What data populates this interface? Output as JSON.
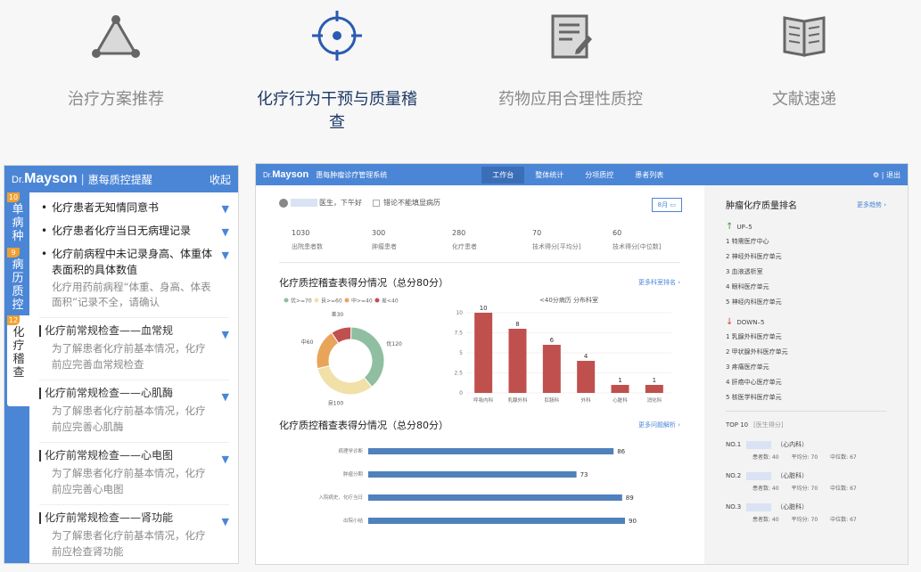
{
  "features": [
    {
      "label": "治疗方案推荐",
      "icon": "triangle-network-icon"
    },
    {
      "label": "化疗行为干预与质量稽查",
      "icon": "target-icon",
      "active": true
    },
    {
      "label": "药物应用合理性质控",
      "icon": "document-edit-icon"
    },
    {
      "label": "文献速递",
      "icon": "book-icon"
    }
  ],
  "left_panel": {
    "brand_prefix": "Dr.",
    "brand": "Mayson",
    "title": "惠每质控提醒",
    "collapse": "收起",
    "tabs": [
      {
        "badge": "10",
        "label": "单病种"
      },
      {
        "badge": "9",
        "label": "病历质控"
      },
      {
        "badge": "12",
        "label": "化疗稽查"
      }
    ],
    "bullets": [
      {
        "text": "化疗患者无知情同意书"
      },
      {
        "text": "化疗患者化疗当日无病理记录"
      },
      {
        "text": "化疗前病程中未记录身高、体重体表面积的具体数值",
        "desc": "化疗用药前病程“体重、身高、体表面积”记录不全，请确认"
      }
    ],
    "sections": [
      {
        "title": "化疗前常规检查——血常规",
        "desc": "为了解患者化疗前基本情况，化疗前应完善血常规检查"
      },
      {
        "title": "化疗前常规检查——心肌酶",
        "desc": "为了解患者化疗前基本情况，化疗前应完善心肌酶"
      },
      {
        "title": "化疗前常规检查——心电图",
        "desc": "为了解患者化疗前基本情况，化疗前应完善心电图"
      },
      {
        "title": "化疗前常规检查——肾功能",
        "desc": "为了解患者化疗前基本情况，化疗前应检查肾功能"
      }
    ]
  },
  "dashboard": {
    "brand_prefix": "Dr.",
    "brand": "Mayson",
    "system": "惠每肿瘤诊疗管理系统",
    "nav": [
      "工作台",
      "整体统计",
      "分项质控",
      "患者列表"
    ],
    "exit": "⚙ | 退出",
    "greeting": "医生，下午好",
    "checkbox_label": "错论不能填显病历",
    "month": "8月",
    "stats": [
      {
        "value": "1030",
        "label": "出院患者数"
      },
      {
        "value": "300",
        "label": "肿瘤患者"
      },
      {
        "value": "280",
        "label": "化疗患者"
      },
      {
        "value": "70",
        "label": "技术得分[平均分]"
      },
      {
        "value": "60",
        "label": "技术得分[中位数]"
      }
    ],
    "section1_title": "化疗质控稽查表得分情况（总分80分）",
    "section1_more": "更多科室排名 ›",
    "section2_title": "化疗质控稽查表得分情况（总分80分）",
    "section2_more": "更多问题解析 ›",
    "side_title": "肿瘤化疗质量排名",
    "side_more": "更多趋势 ›",
    "up_label": "UP–5",
    "up_list": [
      "1 特需医疗中心",
      "2 神经外科医疗单元",
      "3 血液透析室",
      "4 眼科医疗单元",
      "5 神经内科医疗单元"
    ],
    "down_label": "DOWN–5",
    "down_list": [
      "1 乳腺外科医疗单元",
      "2 甲状腺外科医疗单元",
      "3 疼痛医疗单元",
      "4 肝癌中心医疗单元",
      "5 核医学科医疗单元"
    ],
    "top10_label": "TOP 10",
    "top10_sub": "[医生得分]",
    "top10": [
      {
        "no": "NO.1",
        "dept": "（心内科）",
        "a": "患者数: 40",
        "b": "平均分: 70",
        "c": "中位数: 67"
      },
      {
        "no": "NO.2",
        "dept": "（心脏科）",
        "a": "患者数: 40",
        "b": "平均分: 70",
        "c": "中位数: 67"
      },
      {
        "no": "NO.3",
        "dept": "（心脏科）",
        "a": "患者数: 40",
        "b": "平均分: 70",
        "c": "中位数: 67"
      }
    ]
  },
  "colors": {
    "accent": "#4b86d6",
    "bar_red": "#c0504d",
    "hbar": "#4f81bd",
    "green": "#8fbfa0",
    "yellow": "#f1e0a8",
    "orange": "#e8a55a",
    "red": "#c0504d"
  },
  "chart_data": [
    {
      "type": "pie",
      "legend": [
        "优>=70",
        "良>=60",
        "中>=40",
        "差<40"
      ],
      "slices": [
        {
          "name": "优",
          "value": 120
        },
        {
          "name": "良",
          "value": 100
        },
        {
          "name": "中",
          "value": 60
        },
        {
          "name": "差",
          "value": 30
        }
      ],
      "slice_labels": [
        "优120",
        "良100",
        "中60",
        "差30"
      ]
    },
    {
      "type": "bar",
      "title": "<40分病历 分布科室",
      "categories": [
        "呼吸内科",
        "乳腺外科",
        "肛肠科",
        "外科",
        "心脏科",
        "消化科"
      ],
      "values": [
        10,
        8,
        6,
        4,
        1,
        1
      ],
      "yticks": [
        "10",
        "7.5",
        "5",
        "2.5",
        "0"
      ],
      "ylim": [
        0,
        10
      ]
    },
    {
      "type": "bar",
      "orientation": "horizontal",
      "categories": [
        "病理学诊断",
        "肿瘤分期",
        "入院病史、化疗当日",
        "出院小结"
      ],
      "values": [
        86,
        73,
        89,
        90
      ],
      "xlim": [
        0,
        100
      ]
    }
  ]
}
